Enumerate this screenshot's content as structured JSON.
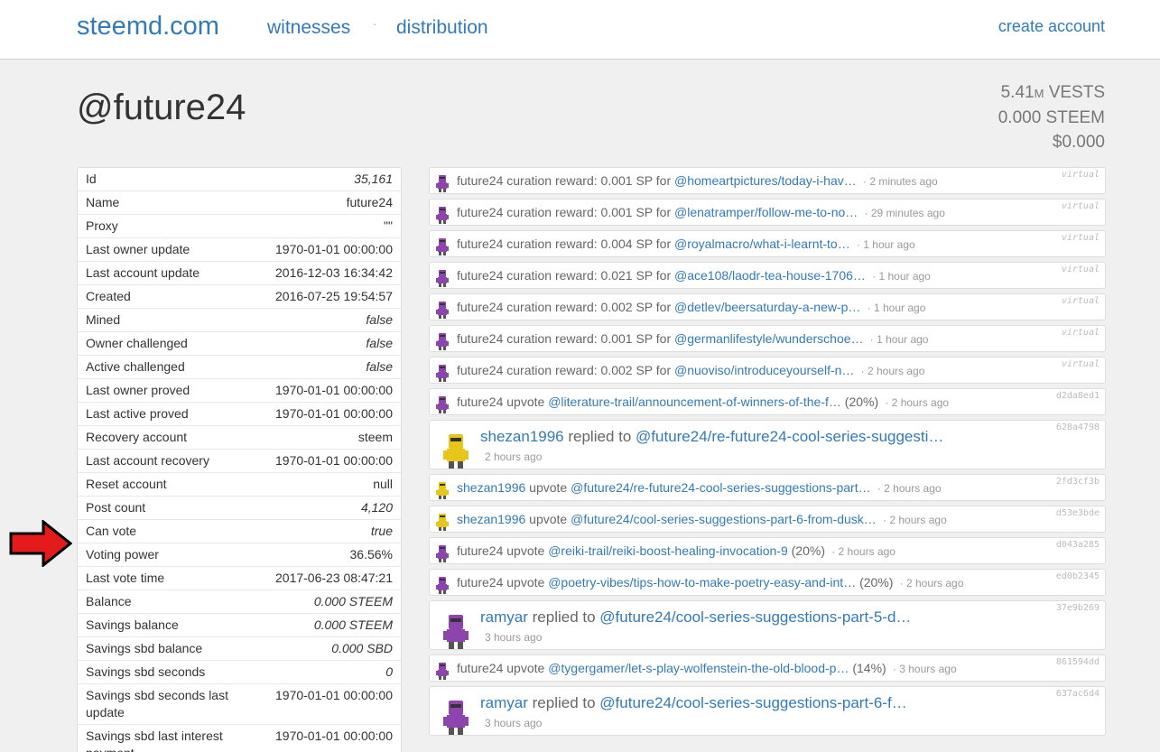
{
  "nav": {
    "brand": "steemd.com",
    "witnesses": "witnesses",
    "separator": "·",
    "distribution": "distribution",
    "create_account": "create account"
  },
  "account": {
    "title": "@future24",
    "vests_value": "5.41",
    "vests_unit_suffix": "M",
    "vests_label": " VESTS",
    "steem": "0.000 STEEM",
    "usd": "$0.000"
  },
  "props": [
    {
      "key": "Id",
      "value": "35,161",
      "italic": true
    },
    {
      "key": "Name",
      "value": "future24",
      "italic": false
    },
    {
      "key": "Proxy",
      "value": "\"\"",
      "italic": false
    },
    {
      "key": "Last owner update",
      "value": "1970-01-01 00:00:00",
      "italic": false
    },
    {
      "key": "Last account update",
      "value": "2016-12-03 16:34:42",
      "italic": false
    },
    {
      "key": "Created",
      "value": "2016-07-25 19:54:57",
      "italic": false
    },
    {
      "key": "Mined",
      "value": "false",
      "italic": true
    },
    {
      "key": "Owner challenged",
      "value": "false",
      "italic": true
    },
    {
      "key": "Active challenged",
      "value": "false",
      "italic": true
    },
    {
      "key": "Last owner proved",
      "value": "1970-01-01 00:00:00",
      "italic": false
    },
    {
      "key": "Last active proved",
      "value": "1970-01-01 00:00:00",
      "italic": false
    },
    {
      "key": "Recovery account",
      "value": "steem",
      "italic": false
    },
    {
      "key": "Last account recovery",
      "value": "1970-01-01 00:00:00",
      "italic": false
    },
    {
      "key": "Reset account",
      "value": "null",
      "italic": false
    },
    {
      "key": "Post count",
      "value": "4,120",
      "italic": true
    },
    {
      "key": "Can vote",
      "value": "true",
      "italic": true
    },
    {
      "key": "Voting power",
      "value": "36.56%",
      "italic": false
    },
    {
      "key": "Last vote time",
      "value": "2017-06-23 08:47:21",
      "italic": false
    },
    {
      "key": "Balance",
      "value": "0.000 STEEM",
      "italic": true
    },
    {
      "key": "Savings balance",
      "value": "0.000 STEEM",
      "italic": true
    },
    {
      "key": "Savings sbd balance",
      "value": "0.000 SBD",
      "italic": true
    },
    {
      "key": "Savings sbd seconds",
      "value": "0",
      "italic": true
    },
    {
      "key": "Savings sbd seconds last update",
      "value": "1970-01-01 00:00:00",
      "italic": false
    },
    {
      "key": "Savings sbd last interest payment",
      "value": "1970-01-01 00:00:00",
      "italic": false
    }
  ],
  "feed": [
    {
      "kind": "small",
      "avatar": "purple",
      "user": "future24",
      "action": " curation reward: 0.001 SP for ",
      "link": "@homeartpictures/today-i-hav…",
      "suffix": "",
      "ago": "2 minutes ago",
      "tag": "virtual",
      "virtual": true
    },
    {
      "kind": "small",
      "avatar": "purple",
      "user": "future24",
      "action": " curation reward: 0.001 SP for ",
      "link": "@lenatramper/follow-me-to-no…",
      "suffix": "",
      "ago": "29 minutes ago",
      "tag": "virtual",
      "virtual": true
    },
    {
      "kind": "small",
      "avatar": "purple",
      "user": "future24",
      "action": " curation reward: 0.004 SP for ",
      "link": "@royalmacro/what-i-learnt-to…",
      "suffix": "",
      "ago": "1 hour ago",
      "tag": "virtual",
      "virtual": true
    },
    {
      "kind": "small",
      "avatar": "purple",
      "user": "future24",
      "action": " curation reward: 0.021 SP for ",
      "link": "@ace108/laodr-tea-house-1706…",
      "suffix": "",
      "ago": "1 hour ago",
      "tag": "virtual",
      "virtual": true
    },
    {
      "kind": "small",
      "avatar": "purple",
      "user": "future24",
      "action": " curation reward: 0.002 SP for ",
      "link": "@detlev/beersaturday-a-new-p…",
      "suffix": "",
      "ago": "1 hour ago",
      "tag": "virtual",
      "virtual": true
    },
    {
      "kind": "small",
      "avatar": "purple",
      "user": "future24",
      "action": " curation reward: 0.001 SP for ",
      "link": "@germanlifestyle/wunderschoe…",
      "suffix": "",
      "ago": "1 hour ago",
      "tag": "virtual",
      "virtual": true
    },
    {
      "kind": "small",
      "avatar": "purple",
      "user": "future24",
      "action": " curation reward: 0.002 SP for ",
      "link": "@nuoviso/introduceyourself-n…",
      "suffix": "",
      "ago": "2 hours ago",
      "tag": "virtual",
      "virtual": true
    },
    {
      "kind": "small",
      "avatar": "purple",
      "user": "future24",
      "action": " upvote ",
      "link": "@literature-trail/announcement-of-winners-of-the-f…",
      "suffix": " (20%)",
      "ago": "2 hours ago",
      "tag": "d2da8ed1",
      "virtual": false
    },
    {
      "kind": "big",
      "avatar": "yellow",
      "user": "shezan1996",
      "action": " replied to ",
      "link": "@future24/re-future24-cool-series-suggesti…",
      "suffix": "",
      "ago": "2 hours ago",
      "tag": "628a4798",
      "virtual": false
    },
    {
      "kind": "small",
      "avatar": "yellow",
      "user": "shezan1996",
      "action": " upvote ",
      "link": "@future24/re-future24-cool-series-suggestions-part…",
      "suffix": "",
      "ago": "2 hours ago",
      "tag": "2fd3cf3b",
      "virtual": false,
      "userlink": true
    },
    {
      "kind": "small",
      "avatar": "yellow",
      "user": "shezan1996",
      "action": " upvote ",
      "link": "@future24/cool-series-suggestions-part-6-from-dusk…",
      "suffix": "",
      "ago": "2 hours ago",
      "tag": "d53e3bde",
      "virtual": false,
      "userlink": true
    },
    {
      "kind": "small",
      "avatar": "purple",
      "user": "future24",
      "action": " upvote ",
      "link": "@reiki-trail/reiki-boost-healing-invocation-9",
      "suffix": " (20%)",
      "ago": "2 hours ago",
      "tag": "d043a285",
      "virtual": false
    },
    {
      "kind": "small",
      "avatar": "purple",
      "user": "future24",
      "action": " upvote ",
      "link": "@poetry-vibes/tips-how-to-make-poetry-easy-and-int…",
      "suffix": " (20%)",
      "ago": "2 hours ago",
      "tag": "ed0b2345",
      "virtual": false
    },
    {
      "kind": "big",
      "avatar": "purple",
      "user": "ramyar",
      "action": " replied to ",
      "link": "@future24/cool-series-suggestions-part-5-d…",
      "suffix": "",
      "ago": "3 hours ago",
      "tag": "37e9b269",
      "virtual": false
    },
    {
      "kind": "small",
      "avatar": "purple",
      "user": "future24",
      "action": " upvote ",
      "link": "@tygergamer/let-s-play-wolfenstein-the-old-blood-p…",
      "suffix": " (14%)",
      "ago": "3 hours ago",
      "tag": "861594dd",
      "virtual": false
    },
    {
      "kind": "big",
      "avatar": "purple",
      "user": "ramyar",
      "action": " replied to ",
      "link": "@future24/cool-series-suggestions-part-6-f…",
      "suffix": "",
      "ago": "3 hours ago",
      "tag": "637ac6d4",
      "virtual": false
    }
  ],
  "colors": {
    "link": "#337ab7",
    "avatar_purple": "#8e44ad",
    "avatar_yellow": "#e6c619",
    "arrow": "#e31b1b"
  },
  "icons": {
    "arrow": "right-arrow-icon",
    "avatar": "robot-avatar-icon"
  }
}
